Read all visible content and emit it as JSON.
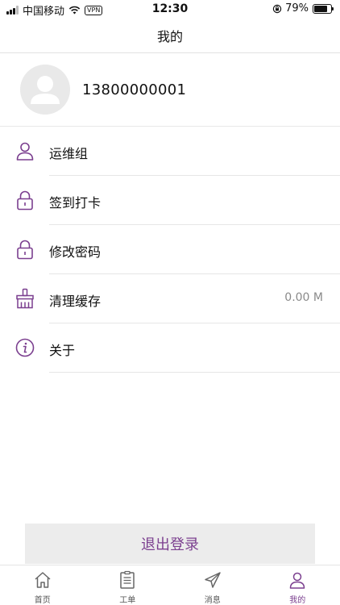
{
  "status_bar": {
    "carrier": "中国移动",
    "vpn": "VPN",
    "time": "12:30",
    "battery_percent": "79%",
    "battery_level": 0.79
  },
  "nav": {
    "title": "我的"
  },
  "profile": {
    "phone": "13800000001"
  },
  "menu": {
    "items": [
      {
        "label": "运维组",
        "icon": "person-icon"
      },
      {
        "label": "签到打卡",
        "icon": "lock-icon"
      },
      {
        "label": "修改密码",
        "icon": "lock-icon"
      },
      {
        "label": "清理缓存",
        "icon": "broom-icon",
        "value": "0.00 M"
      },
      {
        "label": "关于",
        "icon": "info-icon"
      }
    ]
  },
  "logout": {
    "label": "退出登录"
  },
  "tabs": [
    {
      "label": "首页",
      "icon": "home-icon"
    },
    {
      "label": "工单",
      "icon": "clipboard-icon"
    },
    {
      "label": "消息",
      "icon": "send-icon"
    },
    {
      "label": "我的",
      "icon": "person-icon",
      "active": true
    }
  ],
  "colors": {
    "accent": "#7b3f8f",
    "icon_gray": "#666666"
  }
}
